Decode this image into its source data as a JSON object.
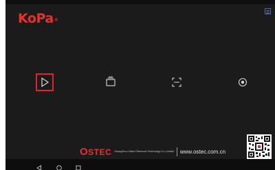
{
  "app": {
    "logo": {
      "part1": "Ko",
      "part2": "Pa",
      "mark": "®"
    }
  },
  "toolbar": {
    "settings_icon": "settings-icon"
  },
  "functions": [
    {
      "name": "play",
      "icon": "play-icon",
      "selected": true
    },
    {
      "name": "gallery",
      "icon": "gallery-icon",
      "selected": false
    },
    {
      "name": "capture",
      "icon": "capture-frame-icon",
      "selected": false
    },
    {
      "name": "camera",
      "icon": "camera-icon",
      "selected": false
    }
  ],
  "footer": {
    "brand_first": "O",
    "brand_rest": "STEC",
    "company": "GuangZhou Ostec Electronic Technology Co.,Limited",
    "website": "www.ostec.com.cn"
  },
  "navbar": {
    "back_icon": "back-triangle-icon",
    "home_icon": "home-circle-icon",
    "recent_icon": "recent-square-icon"
  },
  "colors": {
    "accent": "#e8312f",
    "background": "#1b1b1b",
    "icon": "#d9d9d9",
    "settings_blue": "#3e6fb4"
  }
}
